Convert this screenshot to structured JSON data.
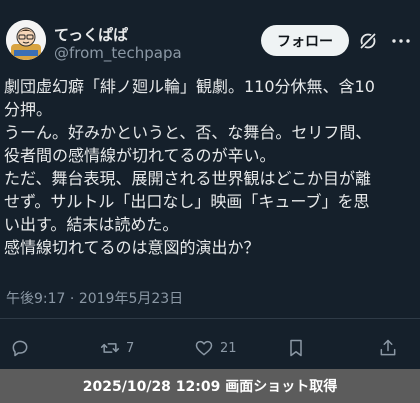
{
  "author": {
    "display_name": "てっくぱぱ",
    "handle": "@from_techpapa",
    "avatar_icon": "cartoon-avatar-icon"
  },
  "header": {
    "follow_label": "フォロー",
    "grok_icon": "grok-icon",
    "more_icon": "more-dots-icon"
  },
  "tweet": {
    "lines": [
      "劇団虚幻癖「緋ノ廻ル輪」観劇。110分休無、含10",
      "分押。",
      "うーん。好みかというと、否、な舞台。セリフ間、",
      "役者間の感情線が切れてるのが辛い。",
      "ただ、舞台表現、展開される世界観はどこか目が離",
      "せず。サルトル「出口なし」映画「キューブ」を思",
      "い出す。結末は読めた。",
      "感情線切れてるのは意図的演出か？"
    ],
    "time": "午後9:17",
    "separator": " · ",
    "date": "2019年5月23日"
  },
  "actions": {
    "reply": {
      "icon": "reply-icon",
      "count": ""
    },
    "retweet": {
      "icon": "retweet-icon",
      "count": "7"
    },
    "like": {
      "icon": "heart-icon",
      "count": "21"
    },
    "bookmark": {
      "icon": "bookmark-icon",
      "count": ""
    },
    "share": {
      "icon": "share-icon",
      "count": ""
    }
  },
  "footer": {
    "caption": "2025/10/28 12:09 画面ショット取得"
  },
  "colors": {
    "background": "#15202b",
    "text_primary": "#e7e9ea",
    "text_secondary": "#8b98a5",
    "footer_bg": "#5c5c5c"
  }
}
